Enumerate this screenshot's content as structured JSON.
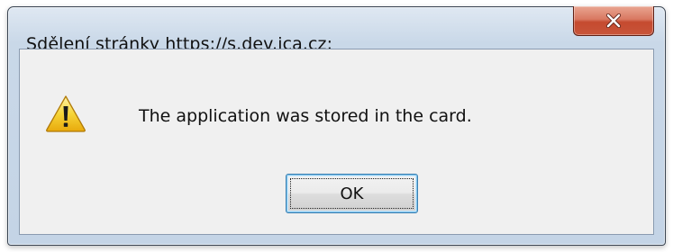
{
  "dialog": {
    "title": "Sdělení stránky https://s.dev.ica.cz:",
    "message": "The application was stored in the card.",
    "ok_label": "OK"
  },
  "icons": {
    "close": "close-icon",
    "warning": "warning-icon"
  },
  "colors": {
    "close_button": "#c8553a",
    "warning_icon": "#f2c322",
    "ok_focus_border": "#3c7fb1"
  }
}
